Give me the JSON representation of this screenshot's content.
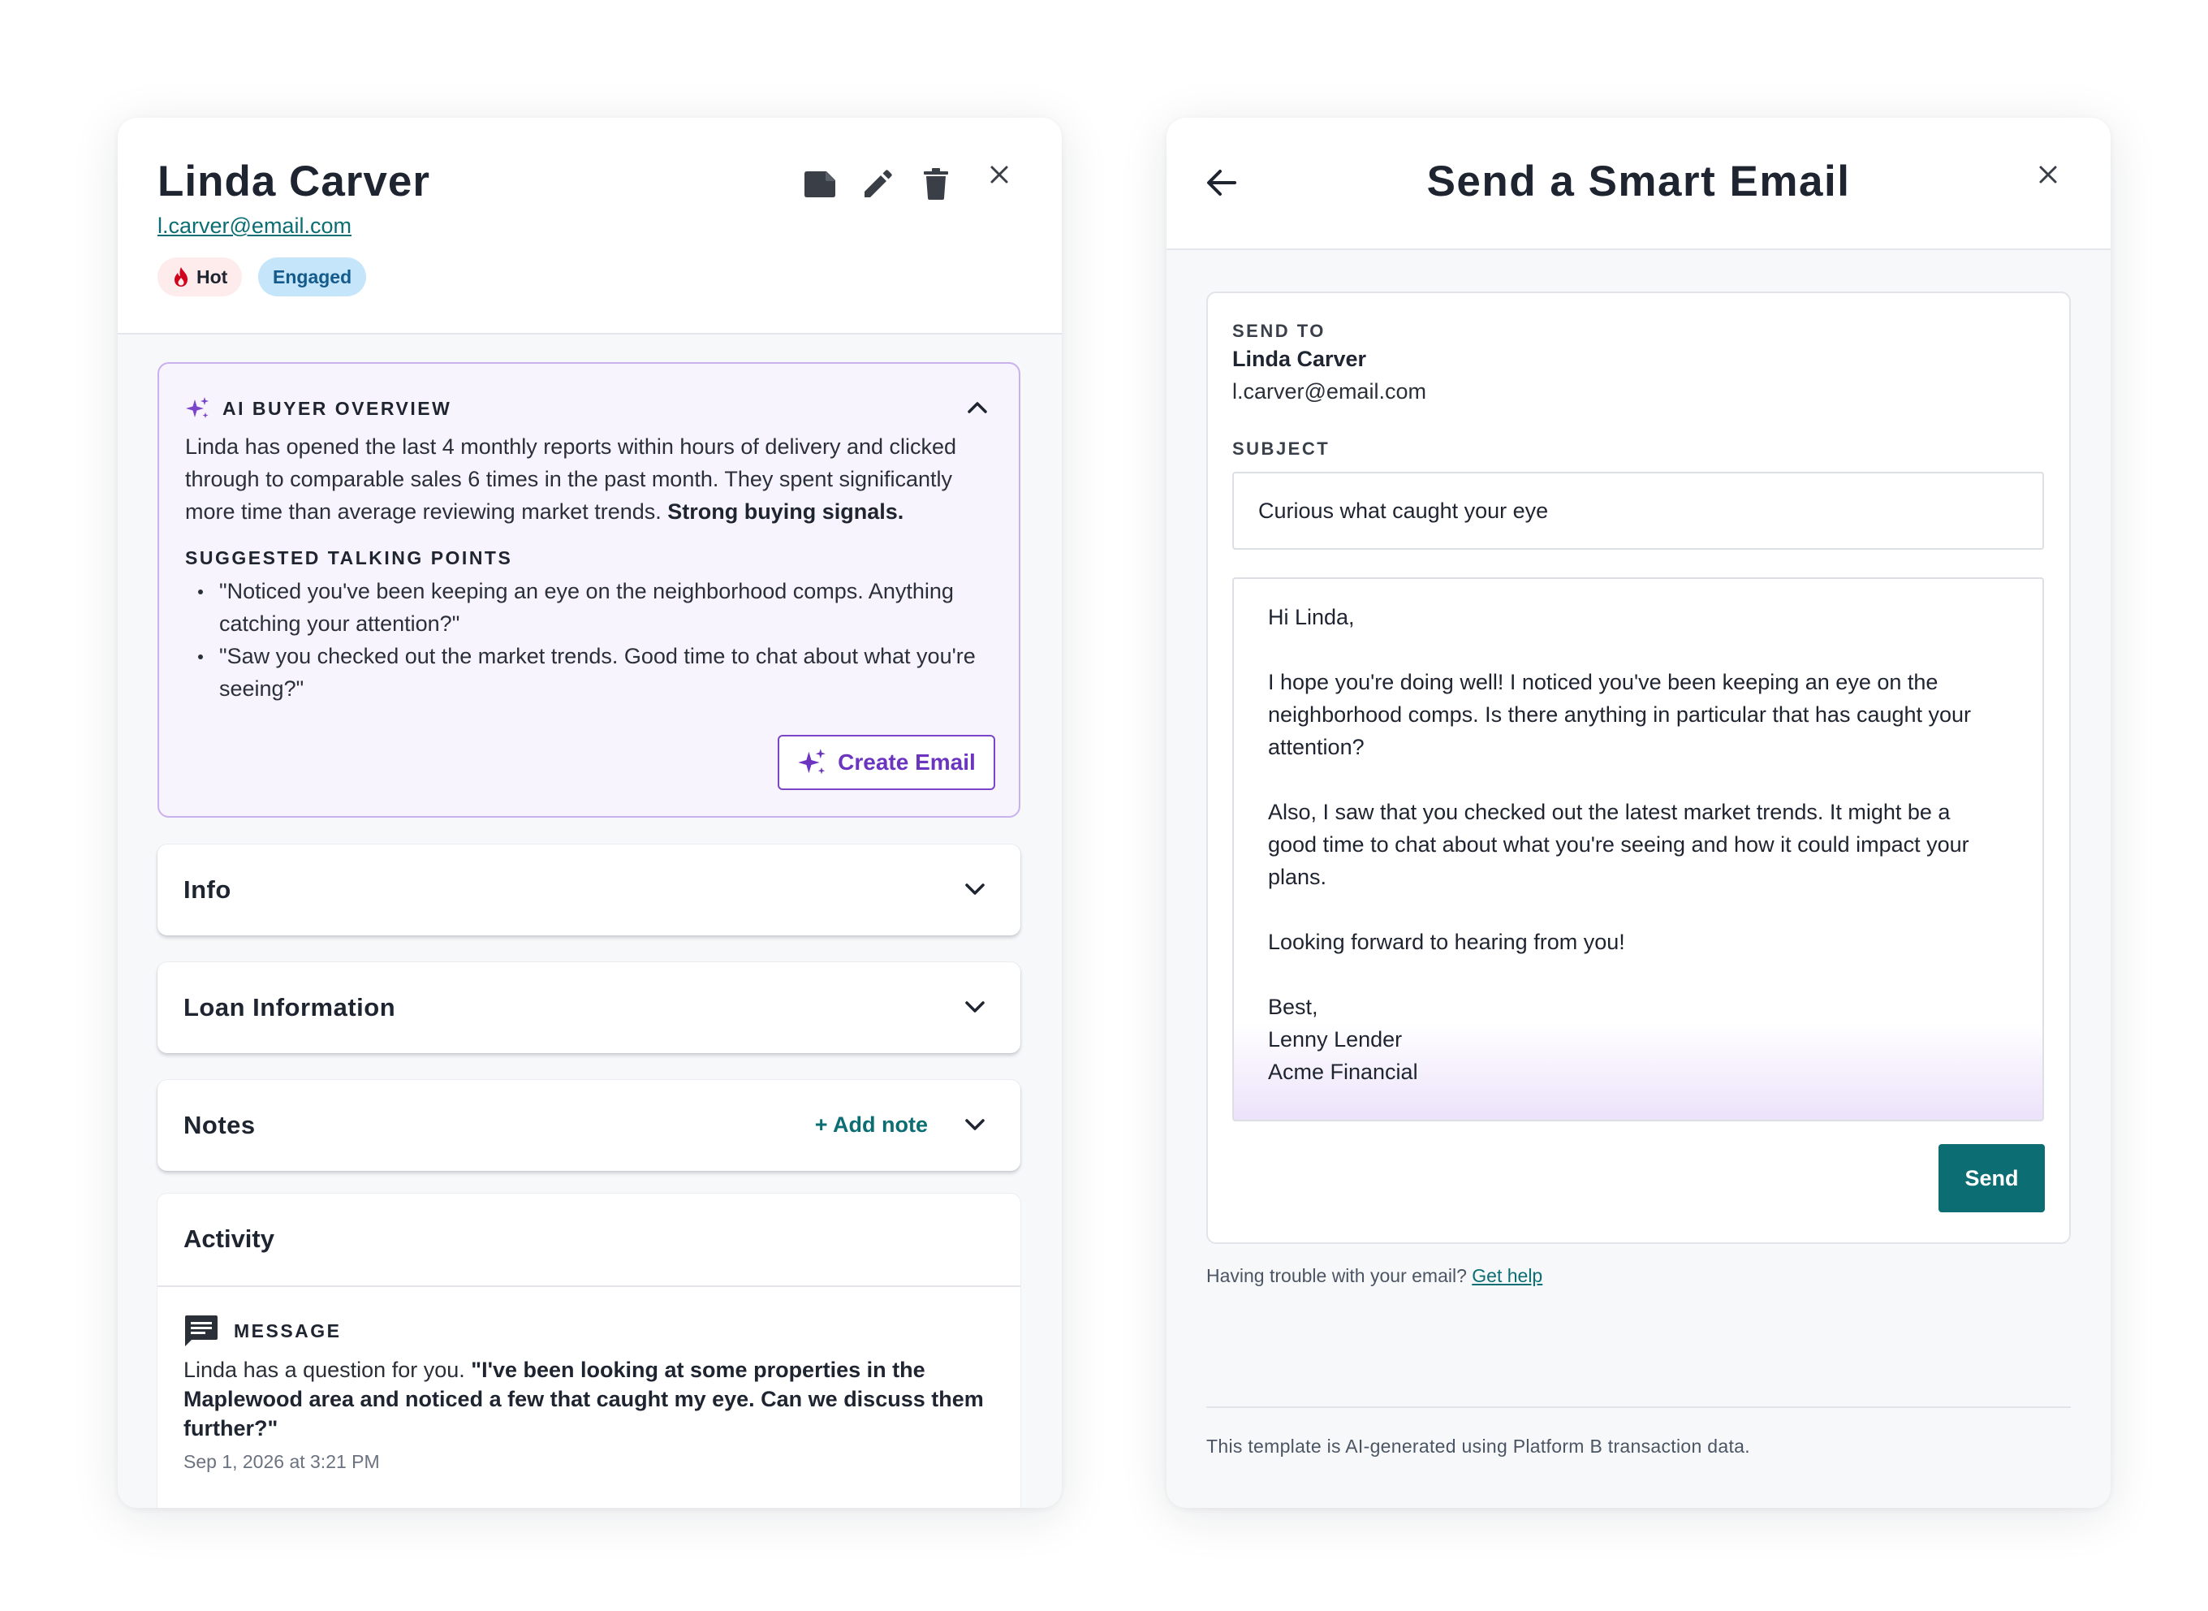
{
  "contact": {
    "name": "Linda Carver",
    "email": "l.carver@email.com",
    "tags": {
      "hot": "Hot",
      "engaged": "Engaged"
    }
  },
  "header_icons": [
    "folder-icon",
    "pencil-icon",
    "trash-icon",
    "close-icon"
  ],
  "ai_overview": {
    "title": "AI BUYER OVERVIEW",
    "summary": "Linda has opened the last 4 monthly reports within hours of delivery and clicked through to comparable sales 6 times in the past month. They spent significantly more time than average reviewing market trends.",
    "signal": "Strong buying signals.",
    "talking_points_title": "SUGGESTED TALKING POINTS",
    "talking_points": [
      "\"Noticed you've been keeping an eye on the neighborhood comps. Anything catching your attention?\"",
      "\"Saw you checked out the market trends. Good time to chat about what you're seeing?\""
    ],
    "create_email_label": "Create Email"
  },
  "sections": {
    "info": "Info",
    "loan": "Loan Information",
    "notes": "Notes",
    "add_note": "+ Add note"
  },
  "activity": {
    "title": "Activity",
    "message_label": "MESSAGE",
    "message_intro": "Linda has a question for you.",
    "message_quote": "\"I've been looking at some properties in the Maplewood area and noticed a few that caught my eye. Can we discuss them further?\"",
    "date": "Sep 1, 2026 at 3:21 PM"
  },
  "smart_email": {
    "title": "Send a Smart Email",
    "send_to_label": "SEND TO",
    "to_name": "Linda Carver",
    "to_email": "l.carver@email.com",
    "subject_label": "SUBJECT",
    "subject_value": "Curious what caught your eye",
    "body_lines": [
      "Hi Linda,",
      "I hope you're doing well! I noticed you've been keeping an eye on the",
      "neighborhood comps. Is there anything in particular that has caught your",
      "attention?",
      "Also, I saw that you checked out the latest market trends. It might be a",
      "good time to chat about what you're seeing and how it could impact your",
      "plans.",
      "Looking forward to hearing from you!",
      "Best,",
      "Lenny Lender",
      "Acme Financial"
    ],
    "send_label": "Send",
    "trouble_text": "Having trouble with your email?",
    "help_link": "Get help",
    "footnote": "This template is AI-generated using Platform B transaction data."
  },
  "colors": {
    "teal": "#0c6e73",
    "purple": "#6b35c0",
    "purple_border": "#c9b1ee",
    "ai_bg": "#f8f4fd",
    "engaged_bg": "#c5e5fa",
    "hot_bg": "#fdeceb",
    "hot_flame": "#d0021b"
  }
}
